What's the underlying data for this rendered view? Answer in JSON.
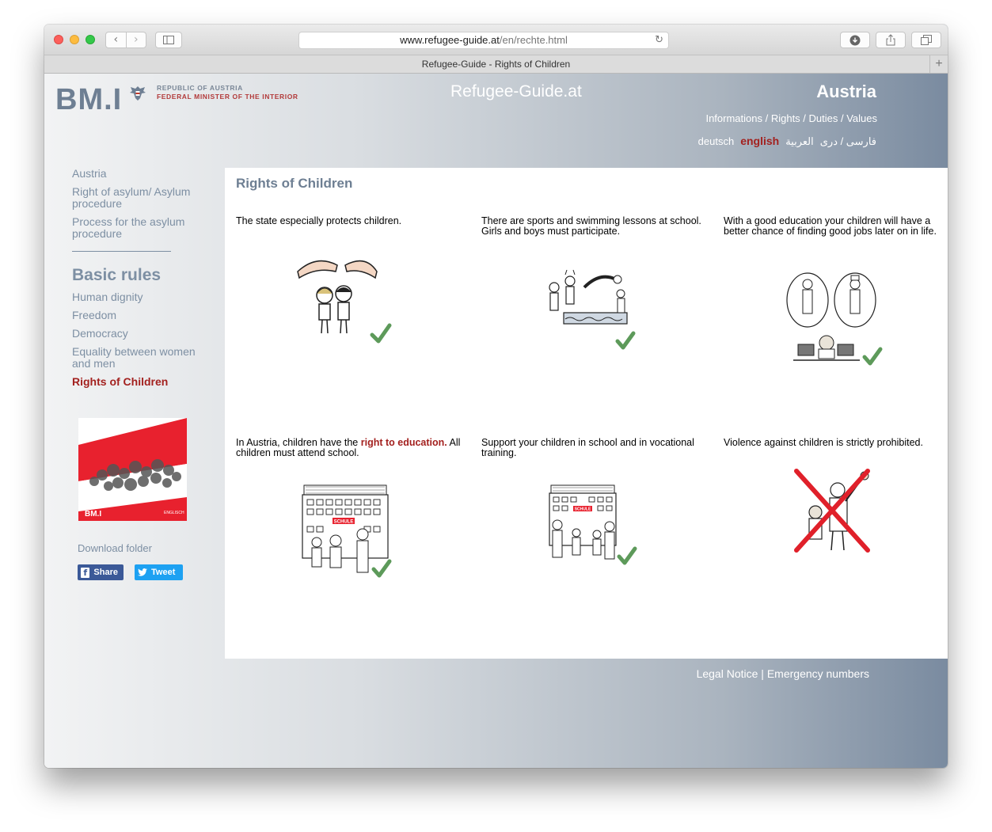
{
  "browser": {
    "url_domain": "www.refugee-guide.at",
    "url_path": "/en/rechte.html",
    "tab_title": "Refugee-Guide - Rights of Children"
  },
  "header": {
    "logo_text": "BM.I",
    "ministry_line1": "REPUBLIC OF AUSTRIA",
    "ministry_line2": "FEDERAL MINISTER OF THE INTERIOR",
    "site_title": "Refugee-Guide.at",
    "country": "Austria",
    "topnav": "Informations / Rights / Duties / Values",
    "languages": [
      {
        "label": "deutsch"
      },
      {
        "label": "english",
        "active": true
      },
      {
        "label": "العربية"
      },
      {
        "label": "فارسی / دری"
      }
    ]
  },
  "sidebar": {
    "links_top": [
      "Austria",
      "Right of asylum/ Asylum procedure",
      "Process for the asylum procedure"
    ],
    "section_heading": "Basic rules",
    "links_basic": [
      "Human dignity",
      "Freedom",
      "Democracy",
      "Equality between women and men"
    ],
    "current": "Rights of Children",
    "download_label": "Download folder",
    "folder_brand": "BM.I",
    "folder_lang": "ENGLISCH",
    "share_label": "Share",
    "tweet_label": "Tweet"
  },
  "main": {
    "title": "Rights of Children",
    "cells": [
      {
        "text": "The state especially protects children.",
        "allowed": true
      },
      {
        "text": "There are sports and swimming lessons at school. Girls and boys must participate.",
        "allowed": true
      },
      {
        "text": "With a good education your children will have a better chance of finding good jobs later on in life.",
        "allowed": true
      },
      {
        "text_before": "In Austria, children have the ",
        "highlight": "right to education.",
        "text_after": " All children must attend school.",
        "allowed": true
      },
      {
        "text": "Support your children in school and in vocational training.",
        "allowed": true
      },
      {
        "text": "Violence against children is strictly prohibited.",
        "allowed": false
      }
    ],
    "school_sign": "SCHULE"
  },
  "footer": {
    "legal": "Legal Notice",
    "separator": "|",
    "emergency": "Emergency numbers"
  },
  "colors": {
    "accent_red": "#a3211f",
    "nav_blue_grey": "#7d8fa3",
    "check_green": "#5d9a5a",
    "cross_red": "#e0202a"
  }
}
